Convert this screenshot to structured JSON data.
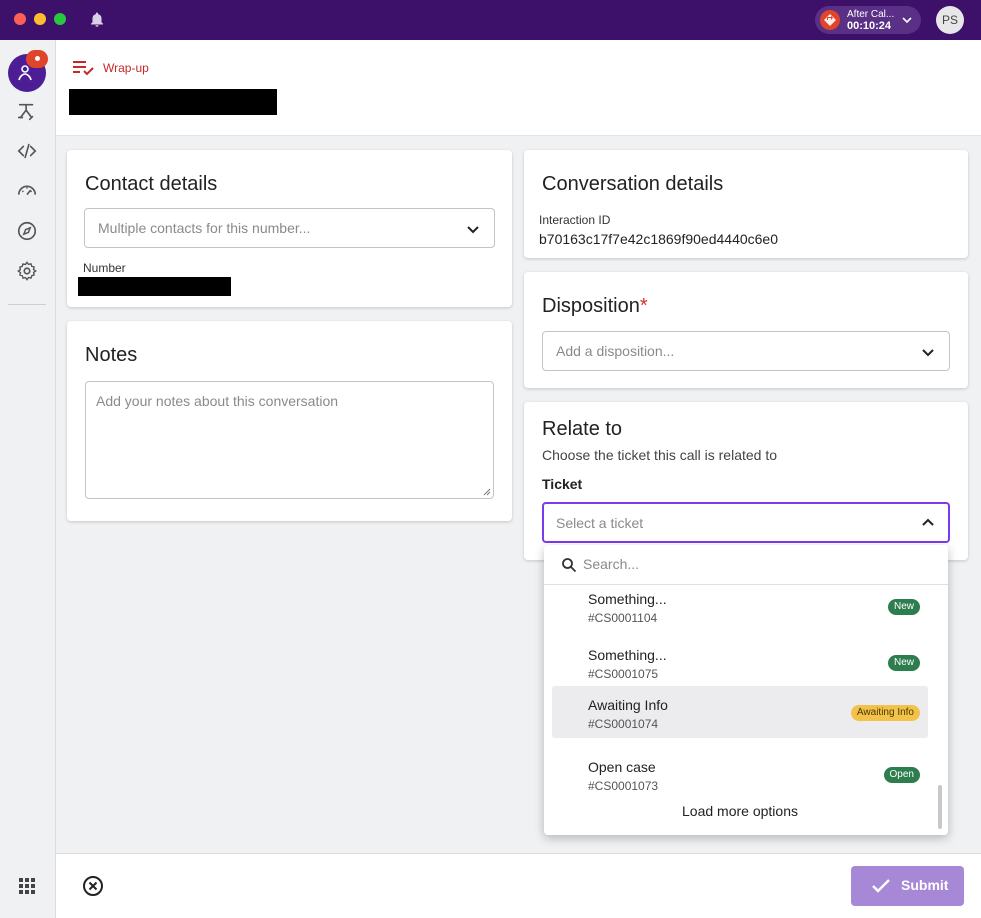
{
  "titlebar": {
    "call_status": "After Cal...",
    "call_timer": "00:10:24",
    "user_initials": "PS"
  },
  "sidebar": {
    "icons": [
      "agent-icon",
      "routing-icon",
      "code-icon",
      "dashboard-icon",
      "compass-icon",
      "settings-icon"
    ]
  },
  "header": {
    "wrap_label": "Wrap-up"
  },
  "contact": {
    "title": "Contact details",
    "contact_placeholder": "Multiple contacts for this number...",
    "number_label": "Number"
  },
  "notes": {
    "title": "Notes",
    "placeholder": "Add your notes about this conversation"
  },
  "conversation": {
    "title": "Conversation details",
    "interaction_label": "Interaction ID",
    "interaction_id": "b70163c17f7e42c1869f90ed4440c6e0"
  },
  "disposition": {
    "title": "Disposition",
    "required_mark": "*",
    "placeholder": "Add a disposition..."
  },
  "relate": {
    "title": "Relate to",
    "subtitle": "Choose the ticket this call is related to",
    "ticket_label": "Ticket",
    "ticket_placeholder": "Select a ticket",
    "search_placeholder": "Search...",
    "options": [
      {
        "title": "Something...",
        "id": "#CS0001104",
        "status": "New"
      },
      {
        "title": "Something...",
        "id": "#CS0001075",
        "status": "New"
      },
      {
        "title": "Awaiting Info",
        "id": "#CS0001074",
        "status": "Awaiting Info"
      },
      {
        "title": "Open case",
        "id": "#CS0001073",
        "status": "Open"
      }
    ],
    "load_more": "Load more options"
  },
  "footer": {
    "submit_label": "Submit"
  },
  "colors": {
    "titlebar": "#3d1169",
    "accent": "#7c3aed",
    "wrap_red": "#c62828",
    "badge_green": "#2e7d4f",
    "badge_yellow": "#f2c24a",
    "submit_disabled": "#a688d6"
  }
}
